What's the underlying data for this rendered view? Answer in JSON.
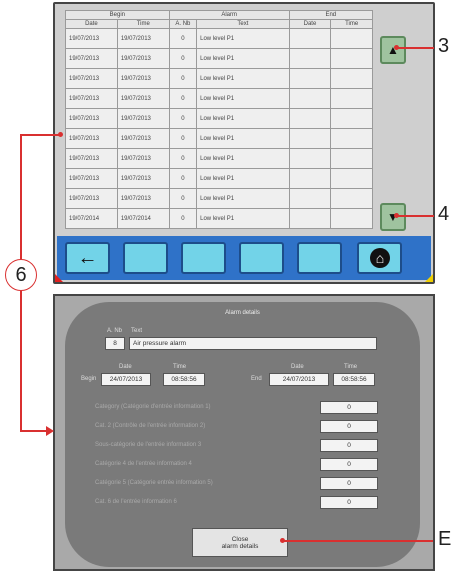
{
  "alarm_list": {
    "columns": {
      "begin_group": "Begin",
      "alarm_group": "Alarm",
      "end_group": "End",
      "begin_date": "Date",
      "begin_time": "Time",
      "a_nb": "A. Nb",
      "text": "Text",
      "end_date": "Date",
      "end_time": "Time"
    },
    "rows": [
      {
        "begin_date": "19/07/2013",
        "begin_time": "19/07/2013",
        "a_nb": "0",
        "text": "Low level P1",
        "end_date": "",
        "end_time": ""
      },
      {
        "begin_date": "19/07/2013",
        "begin_time": "19/07/2013",
        "a_nb": "0",
        "text": "Low level P1",
        "end_date": "",
        "end_time": ""
      },
      {
        "begin_date": "19/07/2013",
        "begin_time": "19/07/2013",
        "a_nb": "0",
        "text": "Low level P1",
        "end_date": "",
        "end_time": ""
      },
      {
        "begin_date": "19/07/2013",
        "begin_time": "19/07/2013",
        "a_nb": "0",
        "text": "Low level P1",
        "end_date": "",
        "end_time": ""
      },
      {
        "begin_date": "19/07/2013",
        "begin_time": "19/07/2013",
        "a_nb": "0",
        "text": "Low level P1",
        "end_date": "",
        "end_time": ""
      },
      {
        "begin_date": "19/07/2013",
        "begin_time": "19/07/2013",
        "a_nb": "0",
        "text": "Low level P1",
        "end_date": "",
        "end_time": ""
      },
      {
        "begin_date": "19/07/2013",
        "begin_time": "19/07/2013",
        "a_nb": "0",
        "text": "Low level P1",
        "end_date": "",
        "end_time": ""
      },
      {
        "begin_date": "19/07/2013",
        "begin_time": "19/07/2013",
        "a_nb": "0",
        "text": "Low level P1",
        "end_date": "",
        "end_time": ""
      },
      {
        "begin_date": "19/07/2013",
        "begin_time": "19/07/2013",
        "a_nb": "0",
        "text": "Low level P1",
        "end_date": "",
        "end_time": ""
      },
      {
        "begin_date": "19/07/2014",
        "begin_time": "19/07/2014",
        "a_nb": "0",
        "text": "Low level P1",
        "end_date": "",
        "end_time": ""
      }
    ],
    "scroll_up_glyph": "▲",
    "scroll_down_glyph": "▼",
    "back_glyph": "←",
    "home_glyph": "⌂"
  },
  "alarm_details": {
    "title": "Alarm details",
    "a_nb_label": "A. Nb",
    "text_label": "Text",
    "a_nb": "8",
    "text": "Air pressure alarm",
    "begin_label": "Begin",
    "begin_date_label": "Date",
    "begin_time_label": "Time",
    "begin_date": "24/07/2013",
    "begin_time": "08:58:56",
    "end_label": "End",
    "end_date_label": "Date",
    "end_time_label": "Time",
    "end_date": "24/07/2013",
    "end_time": "08:58:56",
    "info": [
      {
        "label": "Category (Catégorie d'entrée information 1)",
        "value": "0"
      },
      {
        "label": "Cat. 2 (Contrôle de l'entrée information 2)",
        "value": "0"
      },
      {
        "label": "Sous-catégorie de l'entrée information 3",
        "value": "0"
      },
      {
        "label": "Catégorie 4 de l'entrée information 4",
        "value": "0"
      },
      {
        "label": "Catégorie 5 (Catégorie entrée information 5)",
        "value": "0"
      },
      {
        "label": "Cat. 6 de l'entrée information 6",
        "value": "0"
      }
    ],
    "close_button_line1": "Close",
    "close_button_line2": "alarm details"
  },
  "callouts": {
    "c3": "3",
    "c4": "4",
    "c6": "6",
    "cE": "E"
  },
  "colors": {
    "function_bar": "#2f72c8",
    "function_button": "#72d3e8",
    "scroll_button": "#9fc39f",
    "callout_line": "#d93030"
  }
}
